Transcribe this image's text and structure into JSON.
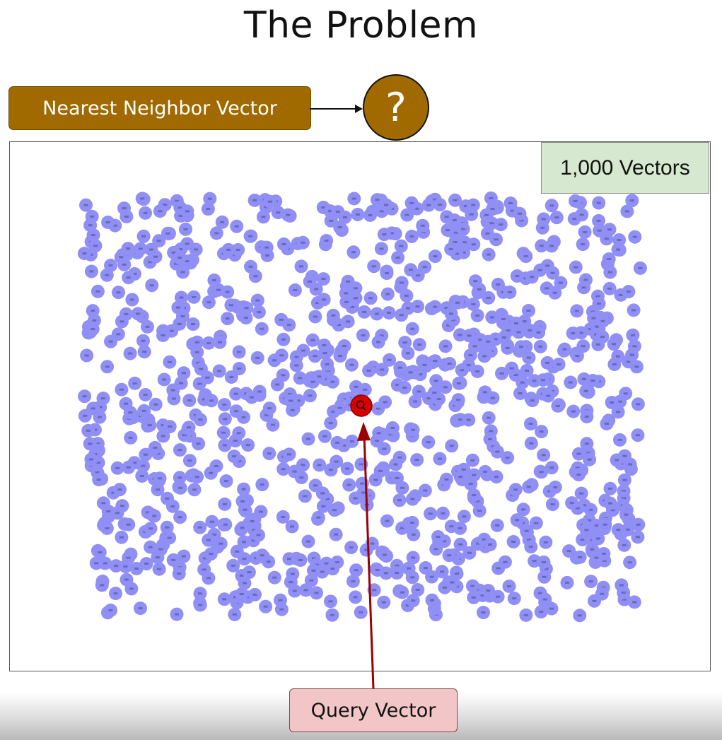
{
  "title": "The Problem",
  "nearest_neighbor": {
    "label": "Nearest Neighbor Vector",
    "unknown": "?"
  },
  "vector_count": "1,000 Vectors",
  "query": {
    "label": "Query Vector"
  },
  "colors": {
    "vector": "#8f8ff5",
    "query_point": "#d90000",
    "nearest_box": "#a06a00",
    "count_box": "#d6e8cf",
    "query_box": "#f2c6c6",
    "query_arrow": "#9c0000"
  },
  "icons": {
    "query_marker": "magnifier-icon"
  }
}
